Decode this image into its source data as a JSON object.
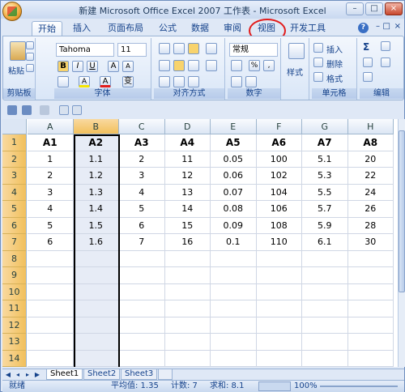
{
  "window": {
    "title": "新建 Microsoft Office Excel 2007 工作表 - Microsoft Excel",
    "controls": [
      "–",
      "□",
      "×"
    ]
  },
  "ribbon_tabs": [
    "开始",
    "插入",
    "页面布局",
    "公式",
    "数据",
    "审阅",
    "视图",
    "开发工具"
  ],
  "ribbon_right": {
    "help": "?",
    "min": "–",
    "restore": "□",
    "close": "×"
  },
  "ribbon": {
    "clipboard": {
      "paste_label": "粘贴",
      "group_label": "剪贴板"
    },
    "font": {
      "name": "Tahoma",
      "size": "11",
      "bold": "B",
      "italic": "I",
      "underline": "U",
      "grow": "A",
      "shrink": "A",
      "fill": "A",
      "color": "A",
      "wen": "变",
      "group_label": "字体"
    },
    "alignment": {
      "group_label": "对齐方式"
    },
    "number": {
      "format": "常规",
      "percent": "%",
      "comma": ",",
      "group_label": "数字"
    },
    "styles": {
      "label": "样式"
    },
    "cells": {
      "insert": "插入",
      "delete": "删除",
      "format": "格式",
      "group_label": "单元格"
    },
    "editing": {
      "sum": "Σ",
      "group_label": "编辑"
    }
  },
  "columns": [
    "A",
    "B",
    "C",
    "D",
    "E",
    "F",
    "G",
    "H"
  ],
  "rows": [
    "1",
    "2",
    "3",
    "4",
    "5",
    "6",
    "7",
    "8",
    "9",
    "10",
    "11",
    "12",
    "13",
    "14"
  ],
  "table": [
    [
      "A1",
      "A2",
      "A3",
      "A4",
      "A5",
      "A6",
      "A7",
      "A8"
    ],
    [
      "1",
      "1.1",
      "2",
      "11",
      "0.05",
      "100",
      "5.1",
      "20"
    ],
    [
      "2",
      "1.2",
      "3",
      "12",
      "0.06",
      "102",
      "5.3",
      "22"
    ],
    [
      "3",
      "1.3",
      "4",
      "13",
      "0.07",
      "104",
      "5.5",
      "24"
    ],
    [
      "4",
      "1.4",
      "5",
      "14",
      "0.08",
      "106",
      "5.7",
      "26"
    ],
    [
      "5",
      "1.5",
      "6",
      "15",
      "0.09",
      "108",
      "5.9",
      "28"
    ],
    [
      "6",
      "1.6",
      "7",
      "16",
      "0.1",
      "110",
      "6.1",
      "30"
    ]
  ],
  "sheets": [
    "Sheet1",
    "Sheet2",
    "Sheet3"
  ],
  "status": {
    "mode": "就绪",
    "average": "平均值: 1.35",
    "count": "计数: 7",
    "sum": "求和: 8.1",
    "zoom": "100%"
  },
  "colors": {
    "selected_header": "#f1c05c",
    "selected_column": "#e7ecf6",
    "annotation": "#e21b1b"
  }
}
